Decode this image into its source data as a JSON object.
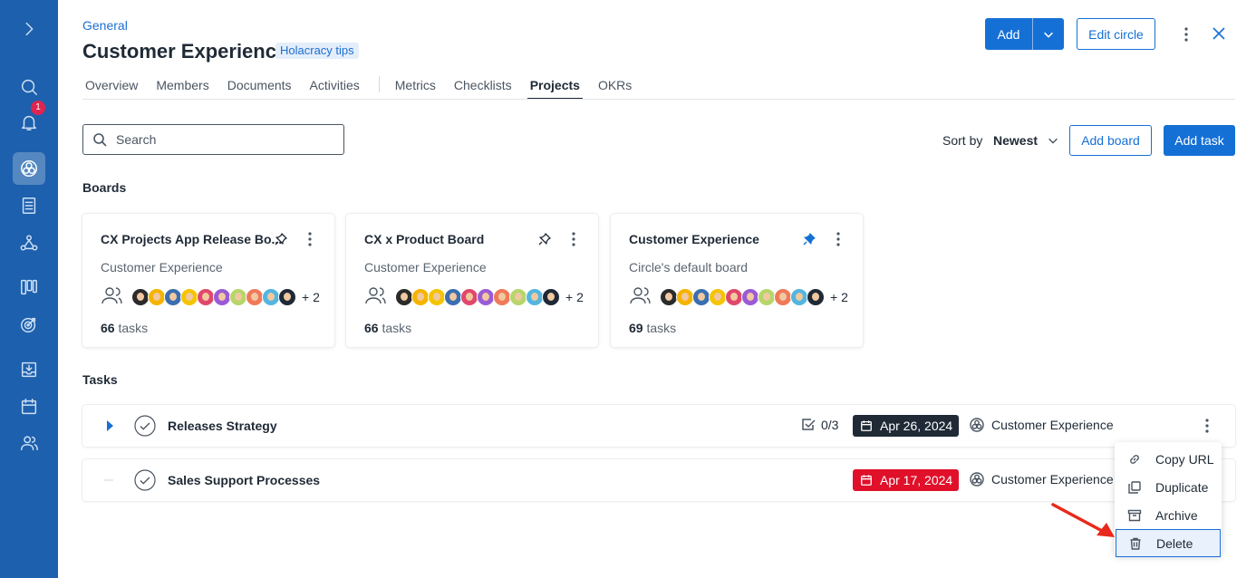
{
  "rail": {
    "items": [
      {
        "name": "expand",
        "icon": "chevron-right-icon"
      },
      {
        "name": "search",
        "icon": "search-icon"
      },
      {
        "name": "notifications",
        "icon": "bell-icon",
        "badge": "1"
      },
      {
        "name": "circles",
        "icon": "circles-icon",
        "active": true
      },
      {
        "name": "documents",
        "icon": "document-icon"
      },
      {
        "name": "roles",
        "icon": "people-network-icon"
      },
      {
        "name": "boards",
        "icon": "kanban-icon"
      },
      {
        "name": "goals",
        "icon": "target-icon"
      },
      {
        "name": "inbox",
        "icon": "inbox-icon"
      },
      {
        "name": "calendar",
        "icon": "calendar-icon"
      },
      {
        "name": "people",
        "icon": "users-icon"
      }
    ]
  },
  "header": {
    "breadcrumb": "General",
    "title": "Customer Experience",
    "tag": "Holacracy tips",
    "add_label": "Add",
    "edit_circle_label": "Edit circle"
  },
  "tabs": [
    {
      "label": "Overview"
    },
    {
      "label": "Members"
    },
    {
      "label": "Documents"
    },
    {
      "label": "Activities"
    },
    {
      "label": "Metrics"
    },
    {
      "label": "Checklists"
    },
    {
      "label": "Projects",
      "active": true
    },
    {
      "label": "OKRs"
    }
  ],
  "toolbar": {
    "search_placeholder": "Search",
    "sort_label": "Sort by",
    "sort_value": "Newest",
    "add_board_label": "Add board",
    "add_task_label": "Add task"
  },
  "boards_section": {
    "title": "Boards",
    "cards": [
      {
        "name": "CX Projects App Release Bo...",
        "subtitle": "Customer Experience",
        "more": "+ 2",
        "count": "66",
        "count_label": "tasks",
        "pinned": false
      },
      {
        "name": "CX x Product Board",
        "subtitle": "Customer Experience",
        "more": "+ 2",
        "count": "66",
        "count_label": "tasks",
        "pinned": false
      },
      {
        "name": "Customer Experience",
        "subtitle": "Circle's default board",
        "more": "+ 2",
        "count": "69",
        "count_label": "tasks",
        "pinned": true
      }
    ]
  },
  "tasks_section": {
    "title": "Tasks",
    "rows": [
      {
        "title": "Releases Strategy",
        "subtasks": "0/3",
        "date": "Apr 26, 2024",
        "date_color": "#1f2a36",
        "circle": "Customer Experience"
      },
      {
        "title": "Sales Support Processes",
        "subtasks": "",
        "date": "Apr 17, 2024",
        "date_color": "#e0102a",
        "circle": "Customer Experience"
      }
    ]
  },
  "context_menu": {
    "items": [
      {
        "label": "Copy URL",
        "icon": "link-icon"
      },
      {
        "label": "Duplicate",
        "icon": "duplicate-icon"
      },
      {
        "label": "Archive",
        "icon": "archive-icon"
      },
      {
        "label": "Delete",
        "icon": "trash-icon",
        "highlighted": true
      }
    ]
  },
  "colors": {
    "rail": "#1d60ad",
    "accent": "#1570d6",
    "annotation_arrow": "#e8291c"
  }
}
